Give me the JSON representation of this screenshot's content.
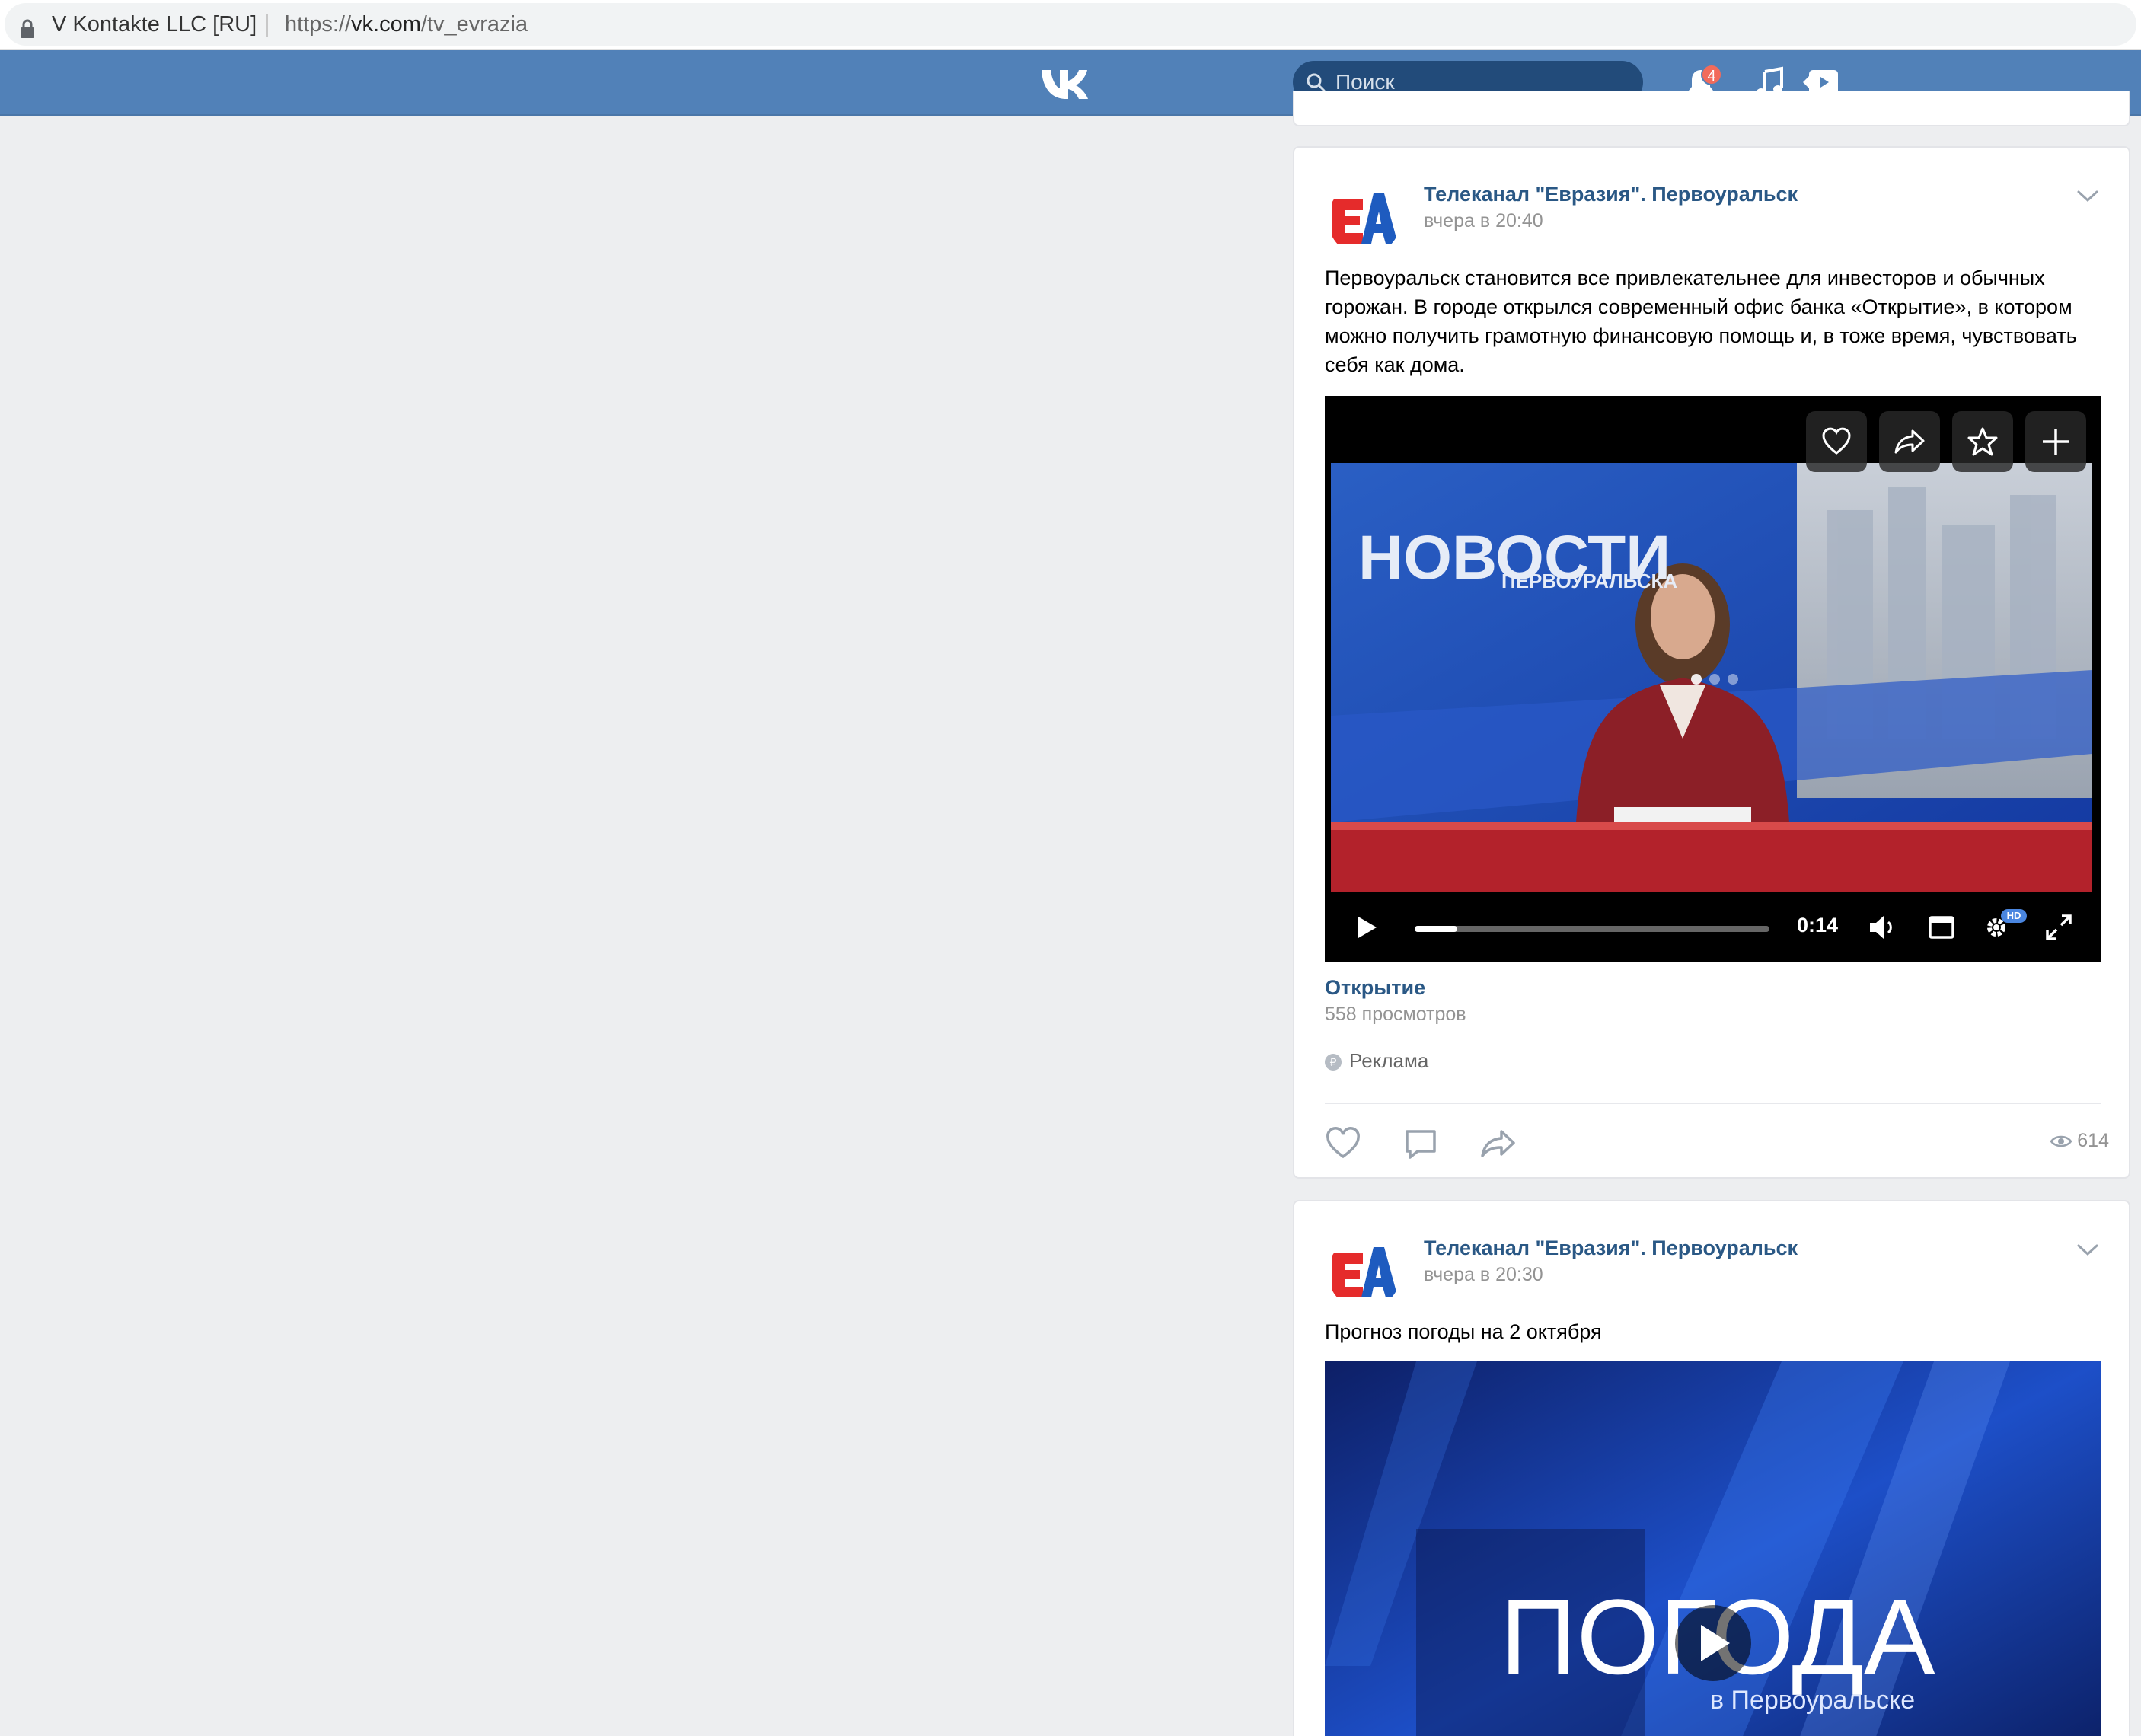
{
  "browser": {
    "site_name": "V Kontakte LLC [RU]",
    "url_scheme": "https://",
    "url_host": "vk.com",
    "url_path": "/tv_evrazia"
  },
  "header": {
    "logo_icon": "vk-logo-icon",
    "search_placeholder": "Поиск",
    "notification_count": "4",
    "icons": [
      "bell-icon",
      "music-icon",
      "video-icon"
    ],
    "accent_color": "#5181b8"
  },
  "posts": [
    {
      "author": "Телеканал \"Евразия\". Первоуральск",
      "time": "вчера в 20:40",
      "text": "Первоуральск становится все привлекательнее для инвесторов и обычных горожан. В городе открылся современный офис банка «Открытие», в котором можно получить грамотную финансовую помощь и, в тоже время, чувствовать себя как дома.",
      "video": {
        "overlay_text_main": "НОВОСТИ",
        "overlay_text_sub": "ПЕРВОУРАЛЬСКА",
        "time": "0:14",
        "progress": 0.12,
        "hd_badge": "HD",
        "title": "Открытие",
        "views": "558 просмотров"
      },
      "ad_label": "Реклама",
      "view_count": "614"
    },
    {
      "author": "Телеканал \"Евразия\". Первоуральск",
      "time": "вчера в 20:30",
      "text": "Прогноз погоды на 2 октября",
      "video": {
        "overlay_text_main": "ПОГОДА",
        "overlay_text_sub": "в Первоуральске"
      }
    }
  ]
}
